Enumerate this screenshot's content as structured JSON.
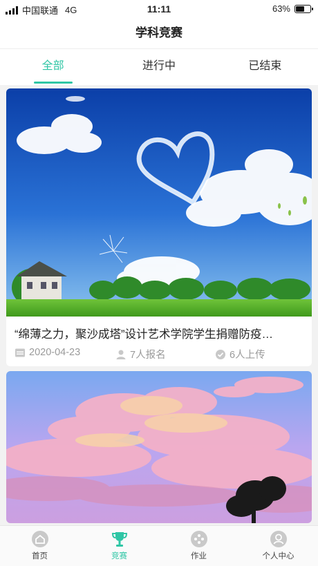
{
  "status": {
    "carrier": "中国联通",
    "network": "4G",
    "time": "11:11",
    "battery": "63%",
    "battery_level": 0.63
  },
  "header": {
    "title": "学科竞赛"
  },
  "tabs": [
    {
      "label": "全部",
      "active": true
    },
    {
      "label": "进行中",
      "active": false
    },
    {
      "label": "已结束",
      "active": false
    }
  ],
  "cards": [
    {
      "title": "“绵薄之力，聚沙成塔”设计艺术学院学生捐赠防疫…",
      "date": "2020-04-23",
      "signups": "7人报名",
      "uploads": "6人上传",
      "image": "blue sky with heart-shaped cloud"
    },
    {
      "image": "pink sunset clouds"
    }
  ],
  "nav": [
    {
      "label": "首页",
      "icon": "home-icon",
      "active": false
    },
    {
      "label": "竞赛",
      "icon": "trophy-icon",
      "active": true
    },
    {
      "label": "作业",
      "icon": "homework-icon",
      "active": false
    },
    {
      "label": "个人中心",
      "icon": "profile-icon",
      "active": false
    }
  ],
  "colors": {
    "accent": "#2fc6a5",
    "meta_text": "#9a9a9a"
  }
}
